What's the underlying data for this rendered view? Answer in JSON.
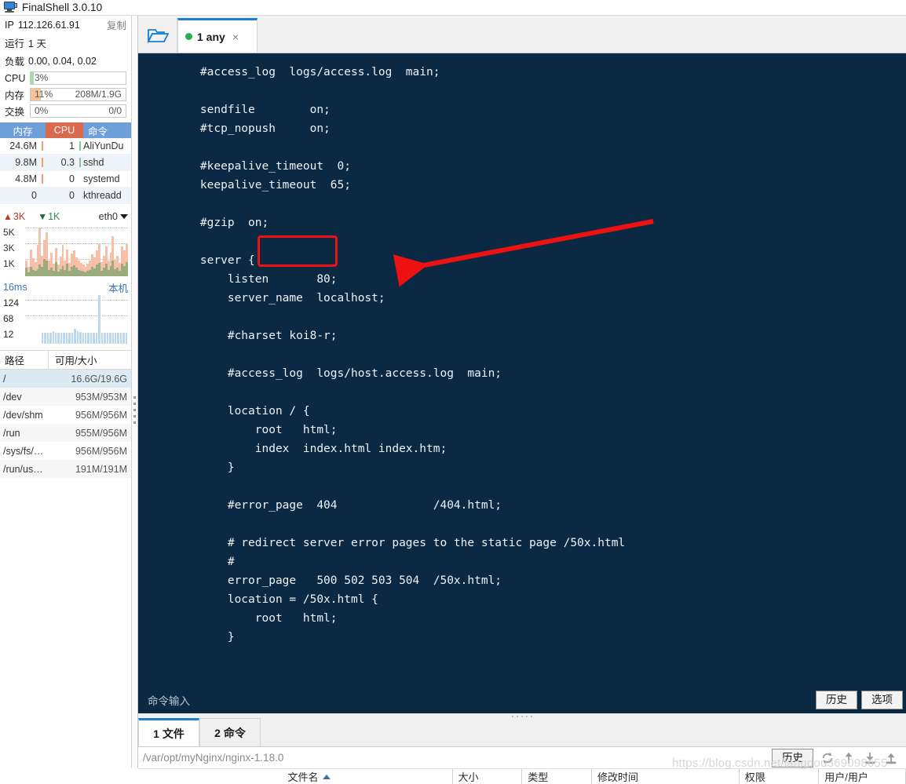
{
  "titlebar": {
    "app_title": "FinalShell 3.0.10",
    "icon": "monitor-icon"
  },
  "sidebar": {
    "ip_label": "IP",
    "ip_value": "112.126.61.91",
    "copy_label": "复制",
    "uptime_label": "运行",
    "uptime_value": "1 天",
    "load_label": "负载",
    "load_value": "0.00, 0.04, 0.02",
    "meters": [
      {
        "label": "CPU",
        "percent": "3%",
        "right": "",
        "fill_pct": 3,
        "fill_color": "#a8d8a8"
      },
      {
        "label": "内存",
        "percent": "11%",
        "right": "208M/1.9G",
        "fill_pct": 11,
        "fill_color": "#f6c49a"
      },
      {
        "label": "交换",
        "percent": "0%",
        "right": "0/0",
        "fill_pct": 0,
        "fill_color": "#cccccc"
      }
    ],
    "process_table": {
      "headers": [
        "内存",
        "CPU",
        "命令"
      ],
      "header_colors": [
        "#6f9fd8",
        "#d96a4f",
        "#6f9fd8"
      ],
      "rows": [
        {
          "mem": "24.6M",
          "cpu": "1",
          "cmd": "AliYunDu"
        },
        {
          "mem": "9.8M",
          "cpu": "0.3",
          "cmd": "sshd"
        },
        {
          "mem": "4.8M",
          "cpu": "0",
          "cmd": "systemd"
        },
        {
          "mem": "0",
          "cpu": "0",
          "cmd": "kthreadd"
        }
      ]
    },
    "network": {
      "up_value": "3K",
      "down_value": "1K",
      "interface": "eth0",
      "y_ticks": [
        "5K",
        "3K",
        "1K"
      ],
      "up_color": "#c0392b",
      "down_color": "#2e8b57"
    },
    "latency": {
      "value": "16ms",
      "host_label": "本机",
      "y_ticks": [
        "124",
        "68",
        "12"
      ]
    },
    "disk_table": {
      "headers": [
        "路径",
        "可用/大小"
      ],
      "rows": [
        {
          "path": "/",
          "avail": "16.6G/19.6G",
          "selected": true
        },
        {
          "path": "/dev",
          "avail": "953M/953M",
          "selected": false
        },
        {
          "path": "/dev/shm",
          "avail": "956M/956M",
          "selected": false
        },
        {
          "path": "/run",
          "avail": "955M/956M",
          "selected": false
        },
        {
          "path": "/sys/fs/…",
          "avail": "956M/956M",
          "selected": false
        },
        {
          "path": "/run/us…",
          "avail": "191M/191M",
          "selected": false
        }
      ]
    }
  },
  "tabbar": {
    "folder_icon": "open-folder-icon",
    "tabs": [
      {
        "label": "1 any",
        "status": "connected",
        "close": "×",
        "active": true
      }
    ]
  },
  "terminal": {
    "background": "#0b2943",
    "foreground": "#eef2f6",
    "lines": [
      "    #access_log  logs/access.log  main;",
      "",
      "    sendfile        on;",
      "    #tcp_nopush     on;",
      "",
      "    #keepalive_timeout  0;",
      "    keepalive_timeout  65;",
      "",
      "    #gzip  on;",
      "",
      "    server {",
      "        listen       80;",
      "        server_name  localhost;",
      "",
      "        #charset koi8-r;",
      "",
      "        #access_log  logs/host.access.log  main;",
      "",
      "        location / {",
      "            root   html;",
      "            index  index.html index.htm;",
      "        }",
      "",
      "        #error_page  404              /404.html;",
      "",
      "        # redirect server error pages to the static page /50x.html",
      "        #",
      "        error_page   500 502 503 504  /50x.html;",
      "        location = /50x.html {",
      "            root   html;",
      "        }",
      ""
    ],
    "annotation": {
      "highlight_text": "80;",
      "highlight_color": "#ee1111",
      "arrow_color": "#ee1111"
    }
  },
  "command_bar": {
    "placeholder": "命令输入",
    "history_button": "历史",
    "options_button": "选项"
  },
  "bottom_tabs": [
    {
      "label": "1 文件",
      "active": true
    },
    {
      "label": "2 命令",
      "active": false
    }
  ],
  "path_bar": {
    "path": "/var/opt/myNginx/nginx-1.18.0",
    "history_button": "历史",
    "tools": [
      "refresh-icon",
      "go-up-icon",
      "download-icon",
      "upload-icon"
    ]
  },
  "file_table": {
    "headers": [
      "文件名",
      "大小",
      "类型",
      "修改时间",
      "权限",
      "用户/用户"
    ],
    "sort_column": "文件名",
    "sort_direction": "asc"
  },
  "watermark": {
    "text": "https://blog.csdn.net/langdou369098655",
    "text2": "https://blog.csdn.net/langdou369098655"
  }
}
